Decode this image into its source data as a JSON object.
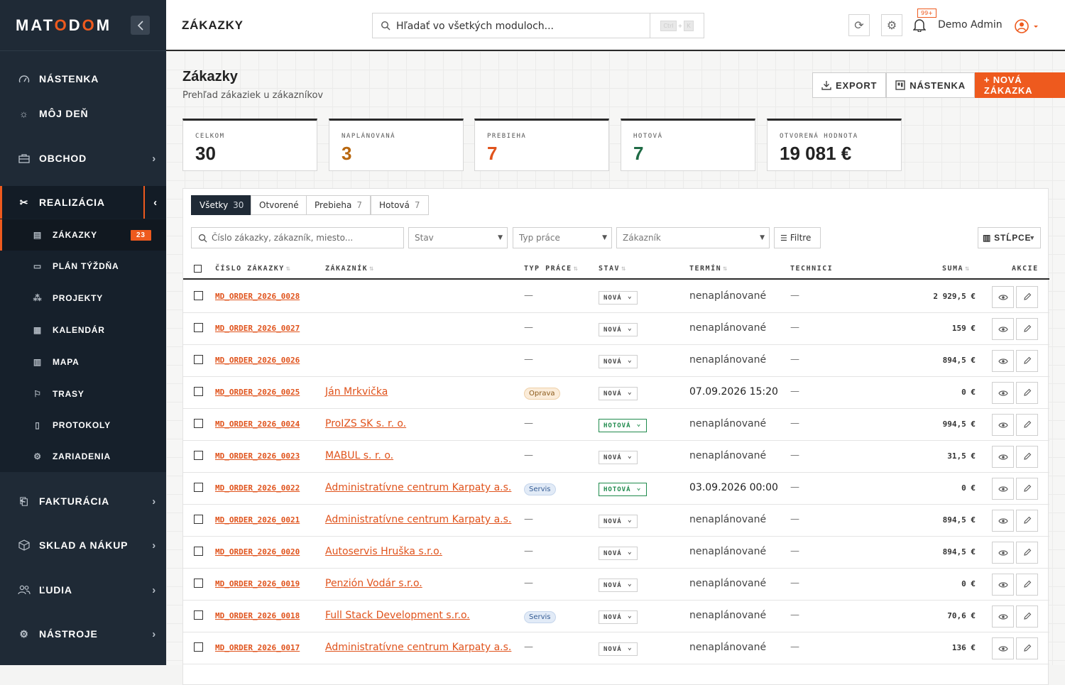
{
  "app": {
    "logo": "MATODOM"
  },
  "sidebar": {
    "items": {
      "nastenka": "NÁSTENKA",
      "moj_den": "MÔJ DEŇ",
      "obchod": "OBCHOD",
      "realizacia": "REALIZÁCIA",
      "fakturacia": "FAKTURÁCIA",
      "sklad": "SKLAD A NÁKUP",
      "ludia": "ĽUDIA",
      "nastroje": "NÁSTROJE"
    },
    "sub": {
      "zakazky": "ZÁKAZKY",
      "zakazky_badge": "23",
      "plan": "PLÁN TÝŽDŇA",
      "projekty": "PROJEKTY",
      "kalendar": "KALENDÁR",
      "mapa": "MAPA",
      "trasy": "TRASY",
      "protokoly": "PROTOKOLY",
      "zariadenia": "ZARIADENIA"
    }
  },
  "topbar": {
    "heading": "ZÁKAZKY",
    "search_placeholder": "Hľadať vo všetkých moduloch...",
    "kbd_ctrl": "Ctrl",
    "kbd_plus": "+",
    "kbd_k": "K",
    "notif_badge": "99+",
    "user": "Demo Admin"
  },
  "page": {
    "title": "Zákazky",
    "subtitle": "Prehľad zákaziek u zákazníkov",
    "export": "EXPORT",
    "nastenka": "NÁSTENKA",
    "new": "+ NOVÁ ZÁKAZKA"
  },
  "stats": [
    {
      "label": "CELKOM",
      "value": "30",
      "color": "#222222"
    },
    {
      "label": "NAPLÁNOVANÁ",
      "value": "3",
      "color": "#b8670f"
    },
    {
      "label": "PREBIEHA",
      "value": "7",
      "color": "#e0531c"
    },
    {
      "label": "HOTOVÁ",
      "value": "7",
      "color": "#1f6b45"
    },
    {
      "label": "OTVORENÁ HODNOTA",
      "value": "19 081 €",
      "color": "#222222"
    }
  ],
  "tabs": [
    {
      "label": "Všetky",
      "count": "30"
    },
    {
      "label": "Otvorené",
      "count": ""
    },
    {
      "label": "Prebieha",
      "count": "7"
    },
    {
      "label": "Hotová",
      "count": "7"
    }
  ],
  "filters": {
    "search_placeholder": "Číslo zákazky, zákazník, miesto...",
    "stav": "Stav",
    "typ": "Typ práce",
    "zakaznik": "Zákazník",
    "filtre": "Filtre",
    "stlpce": "STĹPCE"
  },
  "columns": {
    "cislo": "ČÍSLO ZÁKAZKY",
    "zakaznik": "ZÁKAZNÍK",
    "typ": "TYP PRÁCE",
    "stav": "STAV",
    "termin": "TERMÍN",
    "technici": "TECHNICI",
    "suma": "SUMA",
    "akcie": "AKCIE"
  },
  "rows": [
    {
      "num": "MD_ORDER_2026_0028",
      "cust": "",
      "type": "",
      "state": "NOVÁ",
      "term": "nenaplánované",
      "tech": "—",
      "sum": "2 929,5 €"
    },
    {
      "num": "MD_ORDER_2026_0027",
      "cust": "",
      "type": "",
      "state": "NOVÁ",
      "term": "nenaplánované",
      "tech": "—",
      "sum": "159 €"
    },
    {
      "num": "MD_ORDER_2026_0026",
      "cust": "",
      "type": "",
      "state": "NOVÁ",
      "term": "nenaplánované",
      "tech": "—",
      "sum": "894,5 €"
    },
    {
      "num": "MD_ORDER_2026_0025",
      "cust": "Ján Mrkvička",
      "type": "Oprava",
      "state": "NOVÁ",
      "term": "07.09.2026 15:20",
      "tech": "—",
      "sum": "0 €"
    },
    {
      "num": "MD_ORDER_2026_0024",
      "cust": "ProIZS SK s. r. o.",
      "type": "",
      "state": "HOTOVÁ",
      "term": "nenaplánované",
      "tech": "—",
      "sum": "994,5 €"
    },
    {
      "num": "MD_ORDER_2026_0023",
      "cust": "MABUL s. r. o.",
      "type": "",
      "state": "NOVÁ",
      "term": "nenaplánované",
      "tech": "—",
      "sum": "31,5 €"
    },
    {
      "num": "MD_ORDER_2026_0022",
      "cust": "Administratívne centrum Karpaty a.s.",
      "type": "Servis",
      "state": "HOTOVÁ",
      "term": "03.09.2026 00:00",
      "tech": "—",
      "sum": "0 €"
    },
    {
      "num": "MD_ORDER_2026_0021",
      "cust": "Administratívne centrum Karpaty a.s.",
      "type": "",
      "state": "NOVÁ",
      "term": "nenaplánované",
      "tech": "—",
      "sum": "894,5 €"
    },
    {
      "num": "MD_ORDER_2026_0020",
      "cust": "Autoservis Hruška s.r.o.",
      "type": "",
      "state": "NOVÁ",
      "term": "nenaplánované",
      "tech": "—",
      "sum": "894,5 €"
    },
    {
      "num": "MD_ORDER_2026_0019",
      "cust": "Penzión Vodár s.r.o.",
      "type": "",
      "state": "NOVÁ",
      "term": "nenaplánované",
      "tech": "—",
      "sum": "0 €"
    },
    {
      "num": "MD_ORDER_2026_0018",
      "cust": "Full Stack Development s.r.o.",
      "type": "Servis",
      "state": "NOVÁ",
      "term": "nenaplánované",
      "tech": "—",
      "sum": "70,6 €"
    },
    {
      "num": "MD_ORDER_2026_0017",
      "cust": "Administratívne centrum Karpaty a.s.",
      "type": "",
      "state": "NOVÁ",
      "term": "nenaplánované",
      "tech": "—",
      "sum": "136 €"
    }
  ],
  "empty_dash": "—",
  "colors": {
    "accent": "#ee5a1e",
    "sidebar": "#1f2a36",
    "done": "#1f8a4c"
  }
}
